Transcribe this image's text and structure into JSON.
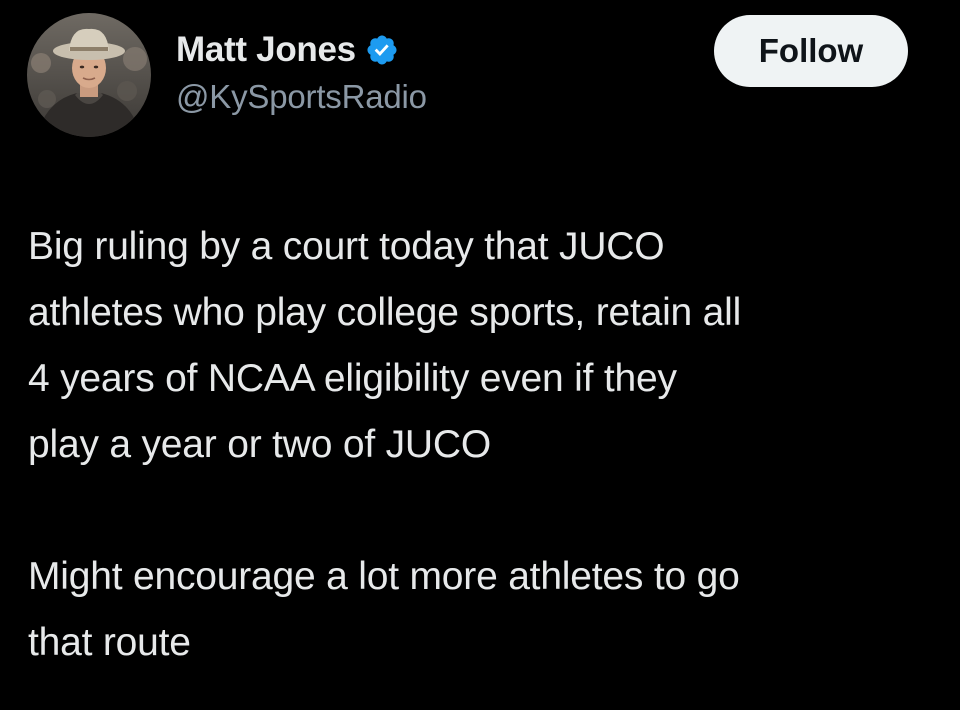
{
  "author": {
    "display_name": "Matt Jones",
    "handle": "@KySportsRadio",
    "verified": true,
    "verified_badge_icon": "verified-badge-icon",
    "avatar_icon": "avatar-photo"
  },
  "follow_button": {
    "label": "Follow"
  },
  "tweet": {
    "paragraphs": [
      "Big ruling by a court today that JUCO\nathletes who play college sports, retain all\n4 years of NCAA eligibility even if they\nplay a year or two of JUCO",
      "Might encourage a lot more athletes to go\nthat route"
    ]
  },
  "colors": {
    "background": "#000000",
    "text": "#e7e9ea",
    "secondary_text": "#8b98a5",
    "verified_blue": "#1d9bf0",
    "follow_button_bg": "#eff3f4",
    "follow_button_text": "#0f1419"
  }
}
